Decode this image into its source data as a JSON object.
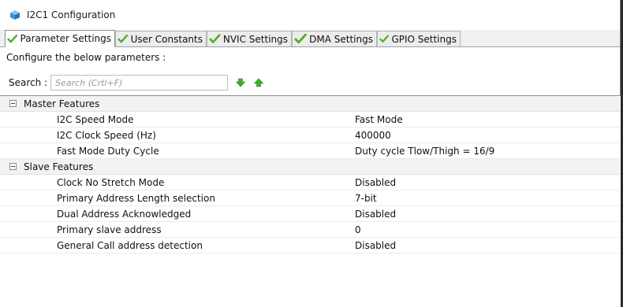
{
  "window": {
    "title": "I2C1 Configuration",
    "app_icon": "cube-icon"
  },
  "tabs": [
    {
      "label": "Parameter Settings",
      "active": true,
      "icon": "check-icon"
    },
    {
      "label": "User Constants",
      "active": false,
      "icon": "check-icon"
    },
    {
      "label": "NVIC Settings",
      "active": false,
      "icon": "check-icon"
    },
    {
      "label": "DMA Settings",
      "active": false,
      "icon": "check-icon"
    },
    {
      "label": "GPIO Settings",
      "active": false,
      "icon": "check-icon"
    }
  ],
  "description": "Configure the below parameters :",
  "search": {
    "label": "Search :",
    "placeholder": "Search (Crtl+F)",
    "prev_icon": "arrow-down-icon",
    "next_icon": "arrow-up-icon"
  },
  "groups": [
    {
      "label": "Master Features",
      "rows": [
        {
          "name": "I2C Speed Mode",
          "value": "Fast Mode"
        },
        {
          "name": "I2C Clock Speed (Hz)",
          "value": "400000"
        },
        {
          "name": "Fast Mode Duty Cycle",
          "value": "Duty cycle Tlow/Thigh = 16/9"
        }
      ]
    },
    {
      "label": "Slave Features",
      "rows": [
        {
          "name": "Clock No Stretch Mode",
          "value": "Disabled"
        },
        {
          "name": "Primary Address Length selection",
          "value": "7-bit"
        },
        {
          "name": "Dual Address Acknowledged",
          "value": "Disabled"
        },
        {
          "name": "Primary slave address",
          "value": "0"
        },
        {
          "name": "General Call address detection",
          "value": "Disabled"
        }
      ]
    }
  ],
  "colors": {
    "check": "#4caf2a",
    "arrow": "#3fae2a",
    "cube": "#3a8fd6"
  }
}
